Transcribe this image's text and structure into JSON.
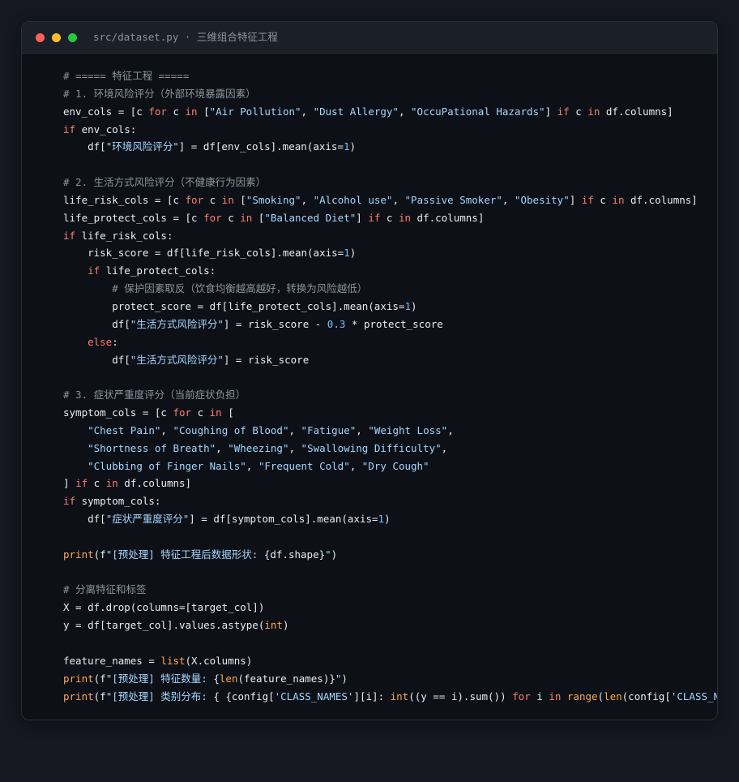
{
  "window": {
    "title": "src/dataset.py · 三维组合特征工程"
  },
  "code_lines": [
    [
      {
        "t": "cm",
        "s": "# ===== 特征工程 ====="
      }
    ],
    [
      {
        "t": "cm",
        "s": "# 1. 环境风险评分（外部环境暴露因素）"
      }
    ],
    [
      {
        "t": "pl",
        "s": "env_cols = [c "
      },
      {
        "t": "kw",
        "s": "for"
      },
      {
        "t": "pl",
        "s": " c "
      },
      {
        "t": "kw",
        "s": "in"
      },
      {
        "t": "pl",
        "s": " ["
      },
      {
        "t": "str",
        "s": "\"Air Pollution\""
      },
      {
        "t": "pl",
        "s": ", "
      },
      {
        "t": "str",
        "s": "\"Dust Allergy\""
      },
      {
        "t": "pl",
        "s": ", "
      },
      {
        "t": "str",
        "s": "\"OccuPational Hazards\""
      },
      {
        "t": "pl",
        "s": "] "
      },
      {
        "t": "kw",
        "s": "if"
      },
      {
        "t": "pl",
        "s": " c "
      },
      {
        "t": "kw",
        "s": "in"
      },
      {
        "t": "pl",
        "s": " df.columns]"
      }
    ],
    [
      {
        "t": "kw",
        "s": "if"
      },
      {
        "t": "pl",
        "s": " env_cols:"
      }
    ],
    [
      {
        "t": "pl",
        "s": "    df["
      },
      {
        "t": "str",
        "s": "\"环境风险评分\""
      },
      {
        "t": "pl",
        "s": "] = df[env_cols].mean(axis="
      },
      {
        "t": "num",
        "s": "1"
      },
      {
        "t": "pl",
        "s": ")"
      }
    ],
    [],
    [
      {
        "t": "cm",
        "s": "# 2. 生活方式风险评分（不健康行为因素）"
      }
    ],
    [
      {
        "t": "pl",
        "s": "life_risk_cols = [c "
      },
      {
        "t": "kw",
        "s": "for"
      },
      {
        "t": "pl",
        "s": " c "
      },
      {
        "t": "kw",
        "s": "in"
      },
      {
        "t": "pl",
        "s": " ["
      },
      {
        "t": "str",
        "s": "\"Smoking\""
      },
      {
        "t": "pl",
        "s": ", "
      },
      {
        "t": "str",
        "s": "\"Alcohol use\""
      },
      {
        "t": "pl",
        "s": ", "
      },
      {
        "t": "str",
        "s": "\"Passive Smoker\""
      },
      {
        "t": "pl",
        "s": ", "
      },
      {
        "t": "str",
        "s": "\"Obesity\""
      },
      {
        "t": "pl",
        "s": "] "
      },
      {
        "t": "kw",
        "s": "if"
      },
      {
        "t": "pl",
        "s": " c "
      },
      {
        "t": "kw",
        "s": "in"
      },
      {
        "t": "pl",
        "s": " df.columns]"
      }
    ],
    [
      {
        "t": "pl",
        "s": "life_protect_cols = [c "
      },
      {
        "t": "kw",
        "s": "for"
      },
      {
        "t": "pl",
        "s": " c "
      },
      {
        "t": "kw",
        "s": "in"
      },
      {
        "t": "pl",
        "s": " ["
      },
      {
        "t": "str",
        "s": "\"Balanced Diet\""
      },
      {
        "t": "pl",
        "s": "] "
      },
      {
        "t": "kw",
        "s": "if"
      },
      {
        "t": "pl",
        "s": " c "
      },
      {
        "t": "kw",
        "s": "in"
      },
      {
        "t": "pl",
        "s": " df.columns]"
      }
    ],
    [
      {
        "t": "kw",
        "s": "if"
      },
      {
        "t": "pl",
        "s": " life_risk_cols:"
      }
    ],
    [
      {
        "t": "pl",
        "s": "    risk_score = df[life_risk_cols].mean(axis="
      },
      {
        "t": "num",
        "s": "1"
      },
      {
        "t": "pl",
        "s": ")"
      }
    ],
    [
      {
        "t": "pl",
        "s": "    "
      },
      {
        "t": "kw",
        "s": "if"
      },
      {
        "t": "pl",
        "s": " life_protect_cols:"
      }
    ],
    [
      {
        "t": "pl",
        "s": "        "
      },
      {
        "t": "cm",
        "s": "# 保护因素取反（饮食均衡越高越好，转换为风险越低）"
      }
    ],
    [
      {
        "t": "pl",
        "s": "        protect_score = df[life_protect_cols].mean(axis="
      },
      {
        "t": "num",
        "s": "1"
      },
      {
        "t": "pl",
        "s": ")"
      }
    ],
    [
      {
        "t": "pl",
        "s": "        df["
      },
      {
        "t": "str",
        "s": "\"生活方式风险评分\""
      },
      {
        "t": "pl",
        "s": "] = risk_score - "
      },
      {
        "t": "num",
        "s": "0.3"
      },
      {
        "t": "pl",
        "s": " * protect_score"
      }
    ],
    [
      {
        "t": "pl",
        "s": "    "
      },
      {
        "t": "kw",
        "s": "else"
      },
      {
        "t": "pl",
        "s": ":"
      }
    ],
    [
      {
        "t": "pl",
        "s": "        df["
      },
      {
        "t": "str",
        "s": "\"生活方式风险评分\""
      },
      {
        "t": "pl",
        "s": "] = risk_score"
      }
    ],
    [],
    [
      {
        "t": "cm",
        "s": "# 3. 症状严重度评分（当前症状负担）"
      }
    ],
    [
      {
        "t": "pl",
        "s": "symptom_cols = [c "
      },
      {
        "t": "kw",
        "s": "for"
      },
      {
        "t": "pl",
        "s": " c "
      },
      {
        "t": "kw",
        "s": "in"
      },
      {
        "t": "pl",
        "s": " ["
      }
    ],
    [
      {
        "t": "pl",
        "s": "    "
      },
      {
        "t": "str",
        "s": "\"Chest Pain\""
      },
      {
        "t": "pl",
        "s": ", "
      },
      {
        "t": "str",
        "s": "\"Coughing of Blood\""
      },
      {
        "t": "pl",
        "s": ", "
      },
      {
        "t": "str",
        "s": "\"Fatigue\""
      },
      {
        "t": "pl",
        "s": ", "
      },
      {
        "t": "str",
        "s": "\"Weight Loss\""
      },
      {
        "t": "pl",
        "s": ","
      }
    ],
    [
      {
        "t": "pl",
        "s": "    "
      },
      {
        "t": "str",
        "s": "\"Shortness of Breath\""
      },
      {
        "t": "pl",
        "s": ", "
      },
      {
        "t": "str",
        "s": "\"Wheezing\""
      },
      {
        "t": "pl",
        "s": ", "
      },
      {
        "t": "str",
        "s": "\"Swallowing Difficulty\""
      },
      {
        "t": "pl",
        "s": ","
      }
    ],
    [
      {
        "t": "pl",
        "s": "    "
      },
      {
        "t": "str",
        "s": "\"Clubbing of Finger Nails\""
      },
      {
        "t": "pl",
        "s": ", "
      },
      {
        "t": "str",
        "s": "\"Frequent Cold\""
      },
      {
        "t": "pl",
        "s": ", "
      },
      {
        "t": "str",
        "s": "\"Dry Cough\""
      }
    ],
    [
      {
        "t": "pl",
        "s": "] "
      },
      {
        "t": "kw",
        "s": "if"
      },
      {
        "t": "pl",
        "s": " c "
      },
      {
        "t": "kw",
        "s": "in"
      },
      {
        "t": "pl",
        "s": " df.columns]"
      }
    ],
    [
      {
        "t": "kw",
        "s": "if"
      },
      {
        "t": "pl",
        "s": " symptom_cols:"
      }
    ],
    [
      {
        "t": "pl",
        "s": "    df["
      },
      {
        "t": "str",
        "s": "\"症状严重度评分\""
      },
      {
        "t": "pl",
        "s": "] = df[symptom_cols].mean(axis="
      },
      {
        "t": "num",
        "s": "1"
      },
      {
        "t": "pl",
        "s": ")"
      }
    ],
    [],
    [
      {
        "t": "bi",
        "s": "print"
      },
      {
        "t": "pl",
        "s": "(f"
      },
      {
        "t": "str",
        "s": "\"[预处理] 特征工程后数据形状: "
      },
      {
        "t": "pl",
        "s": "{df.shape}"
      },
      {
        "t": "str",
        "s": "\""
      },
      {
        "t": "pl",
        "s": ")"
      }
    ],
    [],
    [
      {
        "t": "cm",
        "s": "# 分离特征和标签"
      }
    ],
    [
      {
        "t": "pl",
        "s": "X = df.drop(columns=[target_col])"
      }
    ],
    [
      {
        "t": "pl",
        "s": "y = df[target_col].values.astype("
      },
      {
        "t": "bi",
        "s": "int"
      },
      {
        "t": "pl",
        "s": ")"
      }
    ],
    [],
    [
      {
        "t": "pl",
        "s": "feature_names = "
      },
      {
        "t": "bi",
        "s": "list"
      },
      {
        "t": "pl",
        "s": "(X.columns)"
      }
    ],
    [
      {
        "t": "bi",
        "s": "print"
      },
      {
        "t": "pl",
        "s": "(f"
      },
      {
        "t": "str",
        "s": "\"[预处理] 特征数量: "
      },
      {
        "t": "pl",
        "s": "{"
      },
      {
        "t": "bi",
        "s": "len"
      },
      {
        "t": "pl",
        "s": "(feature_names)}"
      },
      {
        "t": "str",
        "s": "\""
      },
      {
        "t": "pl",
        "s": ")"
      }
    ],
    [
      {
        "t": "bi",
        "s": "print"
      },
      {
        "t": "pl",
        "s": "(f"
      },
      {
        "t": "str",
        "s": "\"[预处理] 类别分布: "
      },
      {
        "t": "pl",
        "s": "{ {config["
      },
      {
        "t": "str",
        "s": "'CLASS_NAMES'"
      },
      {
        "t": "pl",
        "s": "][i]: "
      },
      {
        "t": "bi",
        "s": "int"
      },
      {
        "t": "pl",
        "s": "((y == i).sum()) "
      },
      {
        "t": "kw",
        "s": "for"
      },
      {
        "t": "pl",
        "s": " i "
      },
      {
        "t": "kw",
        "s": "in"
      },
      {
        "t": "pl",
        "s": " "
      },
      {
        "t": "bi",
        "s": "range"
      },
      {
        "t": "pl",
        "s": "("
      },
      {
        "t": "bi",
        "s": "len"
      },
      {
        "t": "pl",
        "s": "(config["
      },
      {
        "t": "str",
        "s": "'CLASS_N"
      }
    ]
  ],
  "colors": {
    "background": "#151821",
    "editor": "#0d1117",
    "titlebar": "#1b1f27",
    "plain": "#e6edf3",
    "comment": "#8b949e",
    "keyword": "#ff7b72",
    "string": "#a5d6ff",
    "number": "#79c0ff",
    "builtin": "#ffa657",
    "dot_close": "#ff5f56",
    "dot_minimize": "#ffbd2e",
    "dot_maximize": "#27c93f"
  }
}
